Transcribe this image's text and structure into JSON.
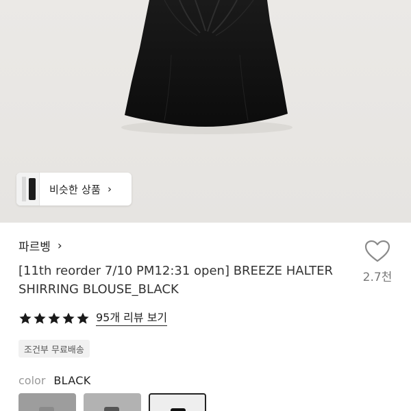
{
  "hero": {
    "image_description_icon": "black-halter-blouse-photo",
    "similar_chip": {
      "label": "비슷한 상품",
      "chevron": "›"
    }
  },
  "product": {
    "brand": "파르벵",
    "brand_chevron": "›",
    "title": "[11th reorder 7/10 PM12:31 open] BREEZE HALTER SHIRRING BLOUSE_BLACK",
    "wish_count": "2.7천",
    "rating_stars": 5,
    "review_link": "95개 리뷰 보기",
    "shipping_badge": "조건부 무료배송",
    "color_label": "color",
    "color_value": "BLACK"
  },
  "colors": {
    "accent": "#222222",
    "muted": "#999999",
    "star": "#1a1a1a"
  }
}
